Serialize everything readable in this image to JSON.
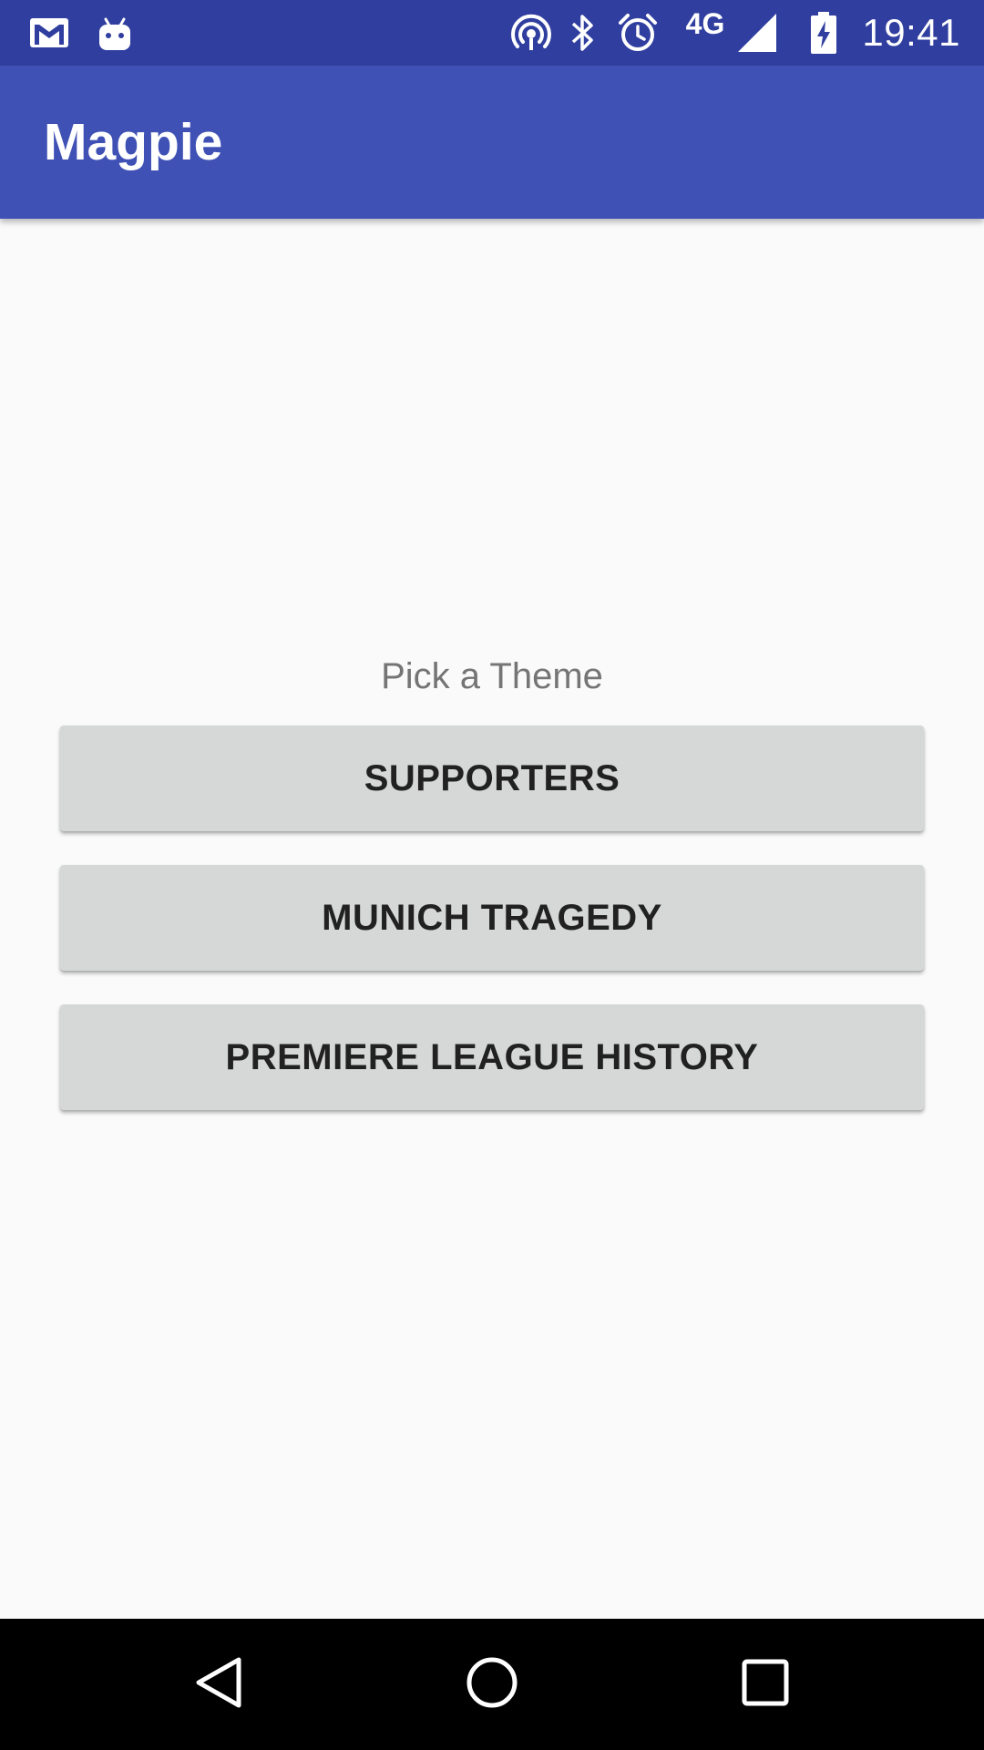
{
  "status_bar": {
    "time": "19:41",
    "network_type": "4G",
    "icons": [
      "gmail-icon",
      "android-icon",
      "hotspot-icon",
      "bluetooth-icon",
      "alarm-icon",
      "signal-icon",
      "battery-charging-icon"
    ]
  },
  "app_bar": {
    "title": "Magpie"
  },
  "main": {
    "prompt": "Pick a Theme",
    "buttons": [
      {
        "label": "SUPPORTERS"
      },
      {
        "label": "MUNICH TRAGEDY"
      },
      {
        "label": "PREMIERE LEAGUE HISTORY"
      }
    ]
  },
  "nav_bar": {
    "icons": [
      "back-icon",
      "home-icon",
      "recents-icon"
    ]
  },
  "colors": {
    "status_bar": "#303f9f",
    "app_bar": "#3f51b5",
    "background": "#fafafa",
    "button": "#d6d7d7",
    "button_text": "#212121",
    "prompt_text": "#757575",
    "nav_bar": "#000000"
  }
}
